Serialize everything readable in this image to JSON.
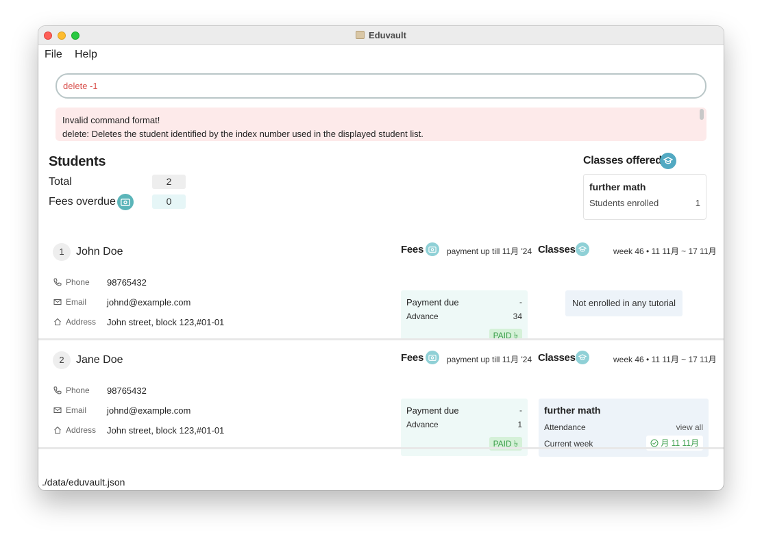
{
  "window": {
    "title": "Eduvault"
  },
  "menu": {
    "file": "File",
    "help": "Help"
  },
  "command": {
    "value": "delete -1"
  },
  "result": {
    "line1": "Invalid command format!",
    "line2": "delete: Deletes the student identified by the index number used in the displayed student list."
  },
  "students_panel": {
    "title": "Students",
    "total_label": "Total",
    "total_value": "2",
    "overdue_label": "Fees overdue",
    "overdue_value": "0"
  },
  "classes_offered": {
    "title": "Classes offered",
    "items": [
      {
        "name": "further math",
        "label": "Students enrolled",
        "count": "1"
      }
    ]
  },
  "labels": {
    "phone": "Phone",
    "email": "Email",
    "address": "Address",
    "fees": "Fees",
    "classes": "Classes",
    "payment_due": "Payment due",
    "advance": "Advance",
    "attendance": "Attendance",
    "view_all": "view all",
    "current_week": "Current week"
  },
  "students": [
    {
      "index": "1",
      "name": "John Doe",
      "phone": "98765432",
      "email": "johnd@example.com",
      "address": "John street, block 123,#01-01",
      "payment_info": "payment up till 11月 '24",
      "payment_due": "-",
      "advance": "34",
      "fee_status": "PAID ৳",
      "week_info": "week 46 • 11 11月 ~ 17 11月",
      "no_tutorial": "Not enrolled in any tutorial"
    },
    {
      "index": "2",
      "name": "Jane Doe",
      "phone": "98765432",
      "email": "johnd@example.com",
      "address": "John street, block 123,#01-01",
      "payment_info": "payment up till 11月 '24",
      "payment_due": "-",
      "advance": "1",
      "fee_status": "PAID ৳",
      "week_info": "week 46 • 11 11月 ~ 17 11月",
      "tutorial": {
        "name": "further math",
        "current_week": "月 11 11月"
      }
    }
  ],
  "status_bar": {
    "path": "./data/eduvault.json"
  },
  "colors": {
    "accent": "#5bb5b9",
    "error_bg": "#fdeaea",
    "paid": "#3a9d4a"
  }
}
